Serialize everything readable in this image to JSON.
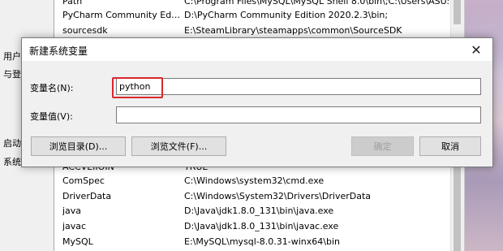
{
  "parent_window": {
    "side_labels": [
      "用户",
      "与登",
      "启动",
      "系统"
    ],
    "top_rows": [
      {
        "name": "Path",
        "value": "C:\\Program Files\\MySQL\\MySQL Shell 8.0\\bin\\;C:\\Users\\ASUS..."
      },
      {
        "name": "PyCharm Community Editi...",
        "value": "D:\\PyCharm Community Edition 2020.2.3\\bin;"
      },
      {
        "name": "sourcesdk",
        "value": "E:\\SteamLibrary\\steamapps\\common\\SourceSDK"
      }
    ],
    "bottom_rows": [
      {
        "name": "ACCVEIIOIN",
        "value": "TRUE"
      },
      {
        "name": "ComSpec",
        "value": "C:\\Windows\\system32\\cmd.exe"
      },
      {
        "name": "DriverData",
        "value": "C:\\Windows\\System32\\Drivers\\DriverData"
      },
      {
        "name": "java",
        "value": "D:\\Java\\jdk1.8.0_131\\bin\\java.exe"
      },
      {
        "name": "javac",
        "value": "D:\\Java\\jdk1.8.0_131\\bin\\javac.exe"
      },
      {
        "name": "MySQL",
        "value": "E:\\MySQL\\mysql-8.0.31-winx64\\bin"
      }
    ]
  },
  "dialog": {
    "title": "新建系统变量",
    "close_icon": "close-icon",
    "name_label": "变量名(N):",
    "name_value": "python",
    "value_label": "变量值(V):",
    "value_value": "",
    "browse_dir_label": "浏览目录(D)...",
    "browse_file_label": "浏览文件(F)...",
    "ok_label": "确定",
    "cancel_label": "取消",
    "highlight_color": "#d8282c"
  }
}
